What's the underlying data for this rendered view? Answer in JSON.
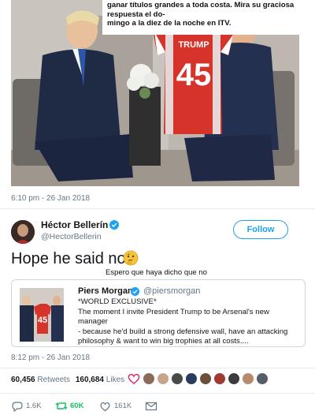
{
  "photo": {
    "caption_line1": "ganar títulos grandes a toda costa. Mira su graciosa respuesta el do-",
    "caption_line2": "mingo a la diez de la noche en ITV.",
    "shirt_name": "TRUMP",
    "shirt_number": "45"
  },
  "tweet": {
    "timestamp": "6:10 pm - 26 Jan 2018",
    "author_name": "Héctor Bellerín",
    "author_handle": "@HectorBellerin",
    "follow_label": "Follow",
    "text": "Hope he said no",
    "translation": "Espero que haya dicho que no",
    "timestamp2": "8:12 pm - 26 Jan 2018"
  },
  "quote": {
    "name": "Piers Morgan",
    "handle": "@piersmorgan",
    "line1": "*WORLD EXCLUSIVE*",
    "line2": "The moment I invite President Trump to be Arsenal's new manager",
    "line3": "- because he'd build a strong defensive wall, have an attacking",
    "line4": "philosophy & want to win big trophies at all costs....",
    "shirt_number": "45"
  },
  "stats": {
    "retweets_count": "60,456",
    "retweets_label": "Retweets",
    "likes_count": "160,684",
    "likes_label": "Likes"
  },
  "actions": {
    "reply_count": "1.6K",
    "retweet_count": "60K",
    "like_count": "161K"
  },
  "colors": {
    "link_blue": "#1da1f2",
    "muted_gray": "#657786",
    "retweet_green": "#17bf63",
    "arsenal_red": "#d6332b"
  }
}
